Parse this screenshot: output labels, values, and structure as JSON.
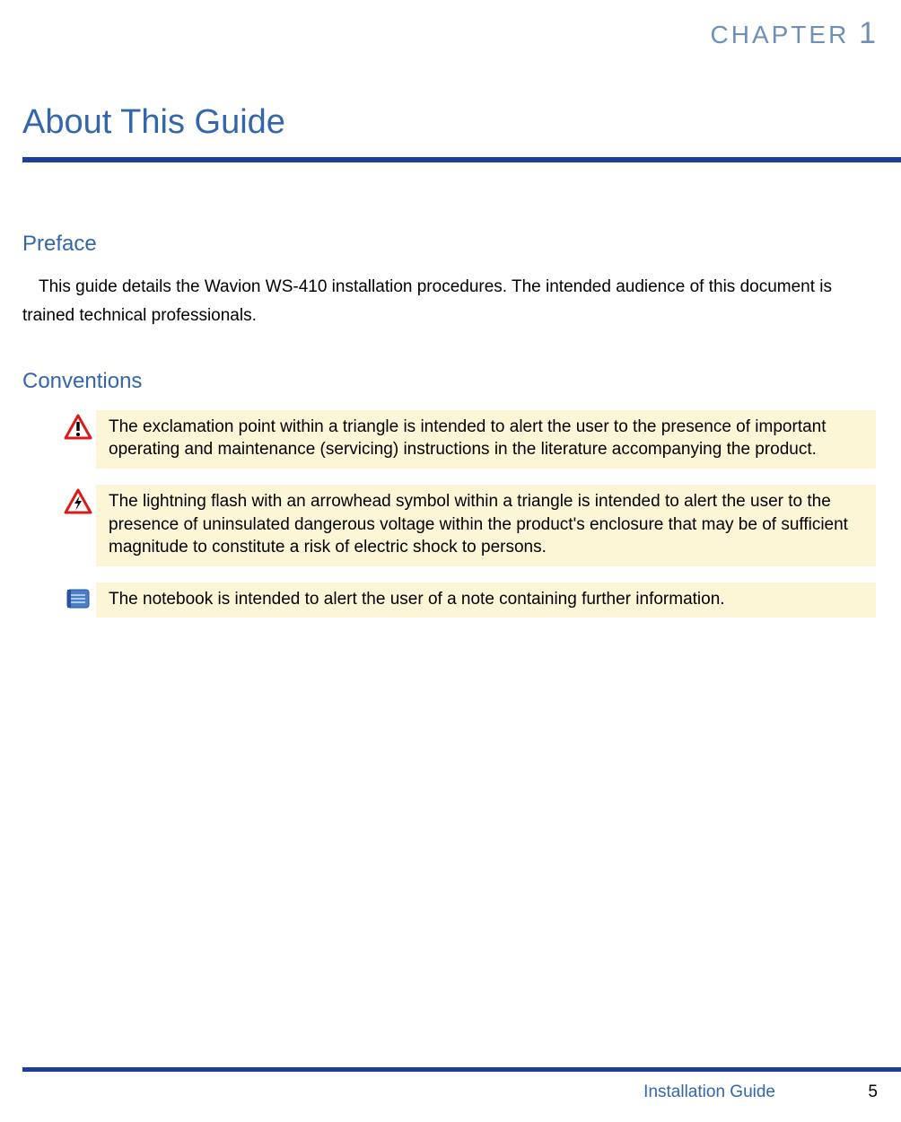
{
  "chapter": {
    "label": "CHAPTER",
    "number": "1"
  },
  "title": "About This Guide",
  "sections": {
    "preface": {
      "heading": "Preface",
      "body": "This guide details the Wavion WS-410 installation procedures. The intended audience of this document is trained technical professionals."
    },
    "conventions": {
      "heading": "Conventions",
      "items": [
        {
          "icon": "exclamation-triangle",
          "text": "The exclamation point within a triangle is intended to alert the user to the presence of important operating and maintenance (servicing) instructions in the literature accompanying the product."
        },
        {
          "icon": "lightning-triangle",
          "text": "The lightning flash with an arrowhead symbol within a triangle is intended to alert the user to the presence of uninsulated dangerous voltage within the product's enclosure that may be of sufficient magnitude to constitute a risk of electric shock to persons."
        },
        {
          "icon": "notebook",
          "text": "The notebook is intended to alert the user of a note containing further information."
        }
      ]
    }
  },
  "footer": {
    "title": "Installation Guide",
    "page": "5"
  }
}
